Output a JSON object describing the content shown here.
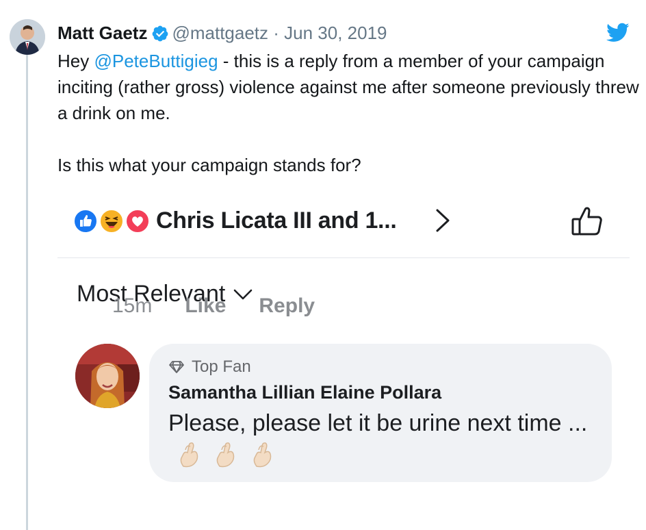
{
  "tweet": {
    "author_name": "Matt Gaetz",
    "handle_date": "@mattgaetz · Jun 30, 2019",
    "text_hey": "Hey ",
    "mention": "@PeteButtigieg",
    "text_rest": " - this is a reply from a member of your campaign inciting (rather gross) violence against me after someone previously threw a drink on me.",
    "text_question": "Is this what your campaign stands for?"
  },
  "facebook": {
    "reactors": "Chris Licata III and 1...",
    "sort_label": "Most Relevant",
    "comment": {
      "badge": "Top Fan",
      "author": "Samantha Lillian Elaine Pollara",
      "text": "Please, please let it be urine next time ...",
      "time": "15m",
      "like_label": "Like",
      "reply_label": "Reply"
    }
  },
  "colors": {
    "twitter_blue": "#1da1f2",
    "mention": "#1b95e0",
    "fb_like_blue": "#1877f2",
    "fb_love_red": "#f33e58",
    "fb_haha_yellow": "#f7b125"
  },
  "icons": [
    "verified-badge-icon",
    "twitter-bird-icon",
    "like-reaction-icon",
    "haha-reaction-icon",
    "love-reaction-icon",
    "chevron-right-icon",
    "thumbs-up-icon",
    "chevron-down-icon",
    "diamond-icon",
    "crossed-fingers-icon"
  ]
}
